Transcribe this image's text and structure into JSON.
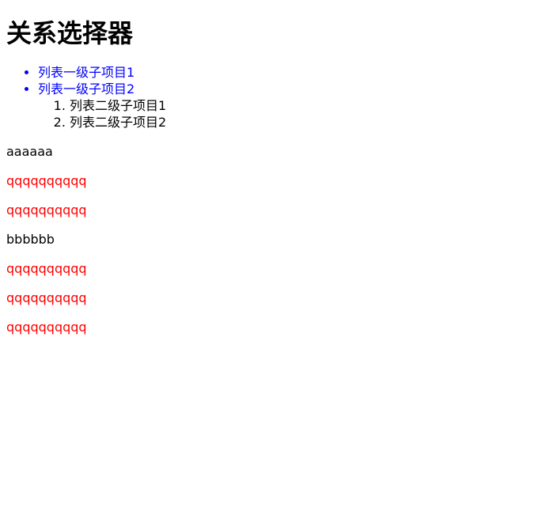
{
  "page": {
    "title": "关系选择器"
  },
  "list": {
    "items": [
      {
        "label": "列表一级子项目1"
      },
      {
        "label": "列表一级子项目2"
      }
    ],
    "sublist": [
      {
        "label": "列表二级子项目1"
      },
      {
        "label": "列表二级子项目2"
      }
    ]
  },
  "paragraphs": [
    {
      "text": "aaaaaa",
      "color": "#000000"
    },
    {
      "text": "qqqqqqqqqq",
      "color": "#ff0000"
    },
    {
      "text": "qqqqqqqqqq",
      "color": "#ff0000"
    },
    {
      "text": "bbbbbb",
      "color": "#000000"
    },
    {
      "text": "qqqqqqqqqq",
      "color": "#ff0000"
    },
    {
      "text": "qqqqqqqqqq",
      "color": "#ff0000"
    },
    {
      "text": "qqqqqqqqqq",
      "color": "#ff0000"
    }
  ],
  "colors": {
    "list_blue": "#0000ff",
    "text_red": "#ff0000",
    "text_black": "#000000"
  }
}
